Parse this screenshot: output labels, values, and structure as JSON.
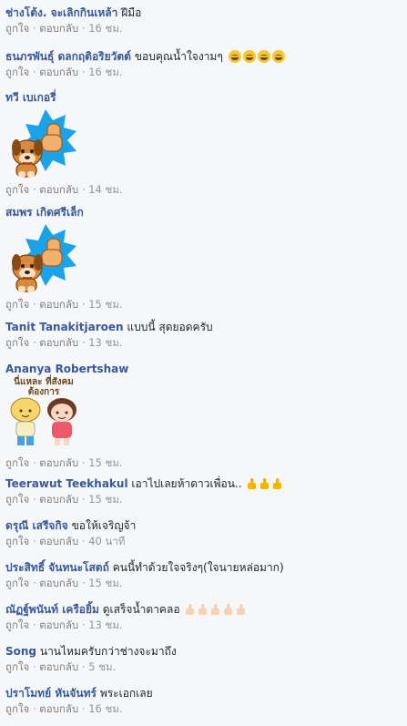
{
  "action_like": "ถูกใจ",
  "action_reply": "ตอบกลับ",
  "separator": "·",
  "comments": [
    {
      "author": "ช่างโต้ง. จะเลิกกินเหล้า",
      "text": "ฝีมือ",
      "time": "16 ชม."
    },
    {
      "author": "ธนภรพันธุ์ ดลกฤติอริยวัตต์",
      "text": "ขอบคุณน้ำใจงามๆ",
      "time": "16 ชม.",
      "emoji": "grinning-squint-icon x4"
    },
    {
      "author": "ทวี เบเกอรี่",
      "text": "",
      "time": "14 ชม.",
      "sticker": "dog-thumbs-up-sticker"
    },
    {
      "author": "สมพร เกิดศรีเล็ก",
      "text": "",
      "time": "15 ชม.",
      "sticker": "dog-thumbs-up-sticker"
    },
    {
      "author": "Tanit Tanakitjaroen",
      "text": "แบบนี้ สุดยอดครับ",
      "time": "13 ชม."
    },
    {
      "author": "Ananya Robertshaw",
      "text": "",
      "time": "15 ชม.",
      "sticker": "two-kids-sticker",
      "sticker_text": "นี่แหละ ที่สังคมต้องการ"
    },
    {
      "author": "Teerawut Teekhakul",
      "text": "เอาไปเลยห้าดาวเพื่อน..",
      "time": "15 ชม.",
      "emoji": "thumbs-up-icon x3"
    },
    {
      "author": "ดรุณี เสรีจกิจ",
      "text": "ขอให้เจริญจ้า",
      "time": "40 นาที"
    },
    {
      "author": "ประสิทธิ์ จันทนะโสตถ์",
      "text": "คนนี้ทำด้วยใจจริงๆ(ใจนายหล่อมาก)",
      "time": "15 ชม."
    },
    {
      "author": "ณัฏฐ์พนันท์ เครือยิ้ม",
      "text": "ดูเสร็จน้ำตาคลอ",
      "time": "13 ชม.",
      "emoji": "thumbs-up-light-icon x5"
    },
    {
      "author": "Song",
      "text": "นานไหมครับกว่าช่างจะมาถึง",
      "time": "5 ชม."
    },
    {
      "author": "ปราโมทย์ หันจันทร์",
      "text": "พระเอกเลย",
      "time": "16 ชม."
    }
  ]
}
